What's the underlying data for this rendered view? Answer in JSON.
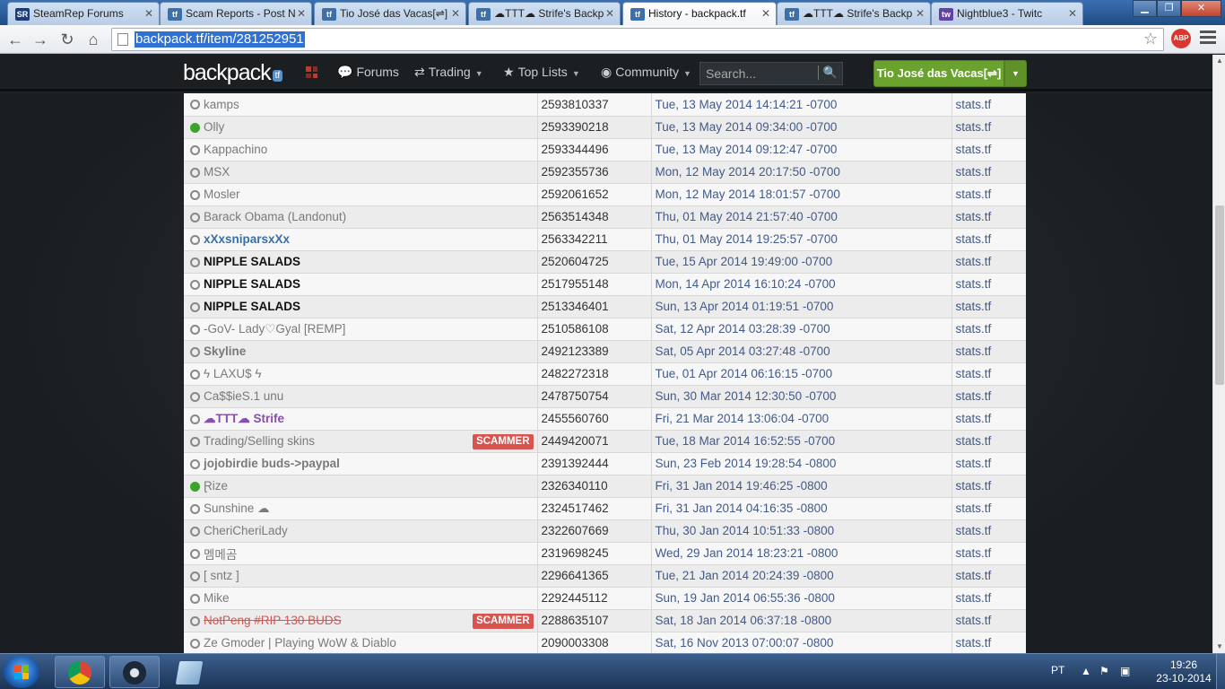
{
  "browser": {
    "tabs": [
      {
        "title": "SteamRep Forums",
        "icon": "SR",
        "color": "#1a3c7a"
      },
      {
        "title": "Scam Reports - Post N",
        "icon": "tf",
        "color": "#3d6fa8"
      },
      {
        "title": "Tio José das Vacas[⇌]",
        "icon": "tf",
        "color": "#3d6fa8"
      },
      {
        "title": "☁TTT☁ Strife's Backp",
        "icon": "tf",
        "color": "#3d6fa8"
      },
      {
        "title": "History - backpack.tf",
        "icon": "tf",
        "color": "#3d6fa8"
      },
      {
        "title": "☁TTT☁ Strife's Backp",
        "icon": "tf",
        "color": "#3d6fa8"
      },
      {
        "title": "Nightblue3 - Twitc",
        "icon": "tw",
        "color": "#6441a5"
      }
    ],
    "url": "backpack.tf/item/281252951",
    "abp_label": "ABP"
  },
  "site": {
    "logo": "backpack",
    "logo_badge": "tf",
    "nav": {
      "forums": "Forums",
      "trading": "Trading",
      "top_lists": "Top Lists",
      "community": "Community"
    },
    "search_placeholder": "Search...",
    "user_name": "Tio José das Vacas[⇌]"
  },
  "history": {
    "rows": [
      {
        "name": "kamps",
        "style": "plain",
        "online": false,
        "scammer": false,
        "id": "2593810337",
        "date": "Tue, 13 May 2014 14:14:21 -0700",
        "stats": "stats.tf"
      },
      {
        "name": "Olly",
        "style": "plain",
        "online": true,
        "scammer": false,
        "id": "2593390218",
        "date": "Tue, 13 May 2014 09:34:00 -0700",
        "stats": "stats.tf"
      },
      {
        "name": "Kappachino",
        "style": "plain",
        "online": false,
        "scammer": false,
        "id": "2593344496",
        "date": "Tue, 13 May 2014 09:12:47 -0700",
        "stats": "stats.tf"
      },
      {
        "name": "MSX",
        "style": "plain",
        "online": false,
        "scammer": false,
        "id": "2592355736",
        "date": "Mon, 12 May 2014 20:17:50 -0700",
        "stats": "stats.tf"
      },
      {
        "name": "Mosler",
        "style": "plain",
        "online": false,
        "scammer": false,
        "id": "2592061652",
        "date": "Mon, 12 May 2014 18:01:57 -0700",
        "stats": "stats.tf"
      },
      {
        "name": "Barack Obama (Landonut)",
        "style": "plain",
        "online": false,
        "scammer": false,
        "id": "2563514348",
        "date": "Thu, 01 May 2014 21:57:40 -0700",
        "stats": "stats.tf"
      },
      {
        "name": "xXxsniparsxXx",
        "style": "blue",
        "online": false,
        "scammer": false,
        "id": "2563342211",
        "date": "Thu, 01 May 2014 19:25:57 -0700",
        "stats": "stats.tf"
      },
      {
        "name": "NIPPLE SALADS",
        "style": "black",
        "online": false,
        "scammer": false,
        "id": "2520604725",
        "date": "Tue, 15 Apr 2014 19:49:00 -0700",
        "stats": "stats.tf"
      },
      {
        "name": "NIPPLE SALADS",
        "style": "black",
        "online": false,
        "scammer": false,
        "id": "2517955148",
        "date": "Mon, 14 Apr 2014 16:10:24 -0700",
        "stats": "stats.tf"
      },
      {
        "name": "NIPPLE SALADS",
        "style": "black",
        "online": false,
        "scammer": false,
        "id": "2513346401",
        "date": "Sun, 13 Apr 2014 01:19:51 -0700",
        "stats": "stats.tf"
      },
      {
        "name": "-GoV- Lady♡Gyal [REMP]",
        "style": "plain",
        "online": false,
        "scammer": false,
        "id": "2510586108",
        "date": "Sat, 12 Apr 2014 03:28:39 -0700",
        "stats": "stats.tf"
      },
      {
        "name": "Skyline",
        "style": "bold",
        "online": false,
        "scammer": false,
        "id": "2492123389",
        "date": "Sat, 05 Apr 2014 03:27:48 -0700",
        "stats": "stats.tf"
      },
      {
        "name": "ϟ LAXU$ ϟ",
        "style": "plain",
        "online": false,
        "scammer": false,
        "id": "2482272318",
        "date": "Tue, 01 Apr 2014 06:16:15 -0700",
        "stats": "stats.tf"
      },
      {
        "name": "Ca$$ieS.1 unu",
        "style": "plain",
        "online": false,
        "scammer": false,
        "id": "2478750754",
        "date": "Sun, 30 Mar 2014 12:30:50 -0700",
        "stats": "stats.tf"
      },
      {
        "name": "☁TTT☁ Strife",
        "style": "purple",
        "online": false,
        "scammer": false,
        "id": "2455560760",
        "date": "Fri, 21 Mar 2014 13:06:04 -0700",
        "stats": "stats.tf"
      },
      {
        "name": "Trading/Selling skins",
        "style": "plain",
        "online": false,
        "scammer": true,
        "id": "2449420071",
        "date": "Tue, 18 Mar 2014 16:52:55 -0700",
        "stats": "stats.tf"
      },
      {
        "name": "jojobirdie buds->paypal",
        "style": "bold",
        "online": false,
        "scammer": false,
        "id": "2391392444",
        "date": "Sun, 23 Feb 2014 19:28:54 -0800",
        "stats": "stats.tf"
      },
      {
        "name": "Ɽize",
        "style": "plain",
        "online": true,
        "scammer": false,
        "id": "2326340110",
        "date": "Fri, 31 Jan 2014 19:46:25 -0800",
        "stats": "stats.tf"
      },
      {
        "name": "Sunshine ☁",
        "style": "plain",
        "online": false,
        "scammer": false,
        "id": "2324517462",
        "date": "Fri, 31 Jan 2014 04:16:35 -0800",
        "stats": "stats.tf"
      },
      {
        "name": "CheriCheriLady",
        "style": "plain",
        "online": false,
        "scammer": false,
        "id": "2322607669",
        "date": "Thu, 30 Jan 2014 10:51:33 -0800",
        "stats": "stats.tf"
      },
      {
        "name": "멤메곰",
        "style": "plain",
        "online": false,
        "scammer": false,
        "id": "2319698245",
        "date": "Wed, 29 Jan 2014 18:23:21 -0800",
        "stats": "stats.tf"
      },
      {
        "name": "[ sntz ]",
        "style": "plain",
        "online": false,
        "scammer": false,
        "id": "2296641365",
        "date": "Tue, 21 Jan 2014 20:24:39 -0800",
        "stats": "stats.tf"
      },
      {
        "name": "Mike",
        "style": "plain",
        "online": false,
        "scammer": false,
        "id": "2292445112",
        "date": "Sun, 19 Jan 2014 06:55:36 -0800",
        "stats": "stats.tf"
      },
      {
        "name": "NotPeng #RIP 130 BUDS",
        "style": "scam",
        "online": false,
        "scammer": true,
        "id": "2288635107",
        "date": "Sat, 18 Jan 2014 06:37:18 -0800",
        "stats": "stats.tf"
      },
      {
        "name": "Ze Gmoder | Playing WoW & Diablo",
        "style": "plain",
        "online": false,
        "scammer": false,
        "id": "2090003308",
        "date": "Sat, 16 Nov 2013 07:00:07 -0800",
        "stats": "stats.tf"
      }
    ],
    "scammer_label": "SCAMMER"
  },
  "taskbar": {
    "language": "PT",
    "time": "19:26",
    "date": "23-10-2014"
  }
}
